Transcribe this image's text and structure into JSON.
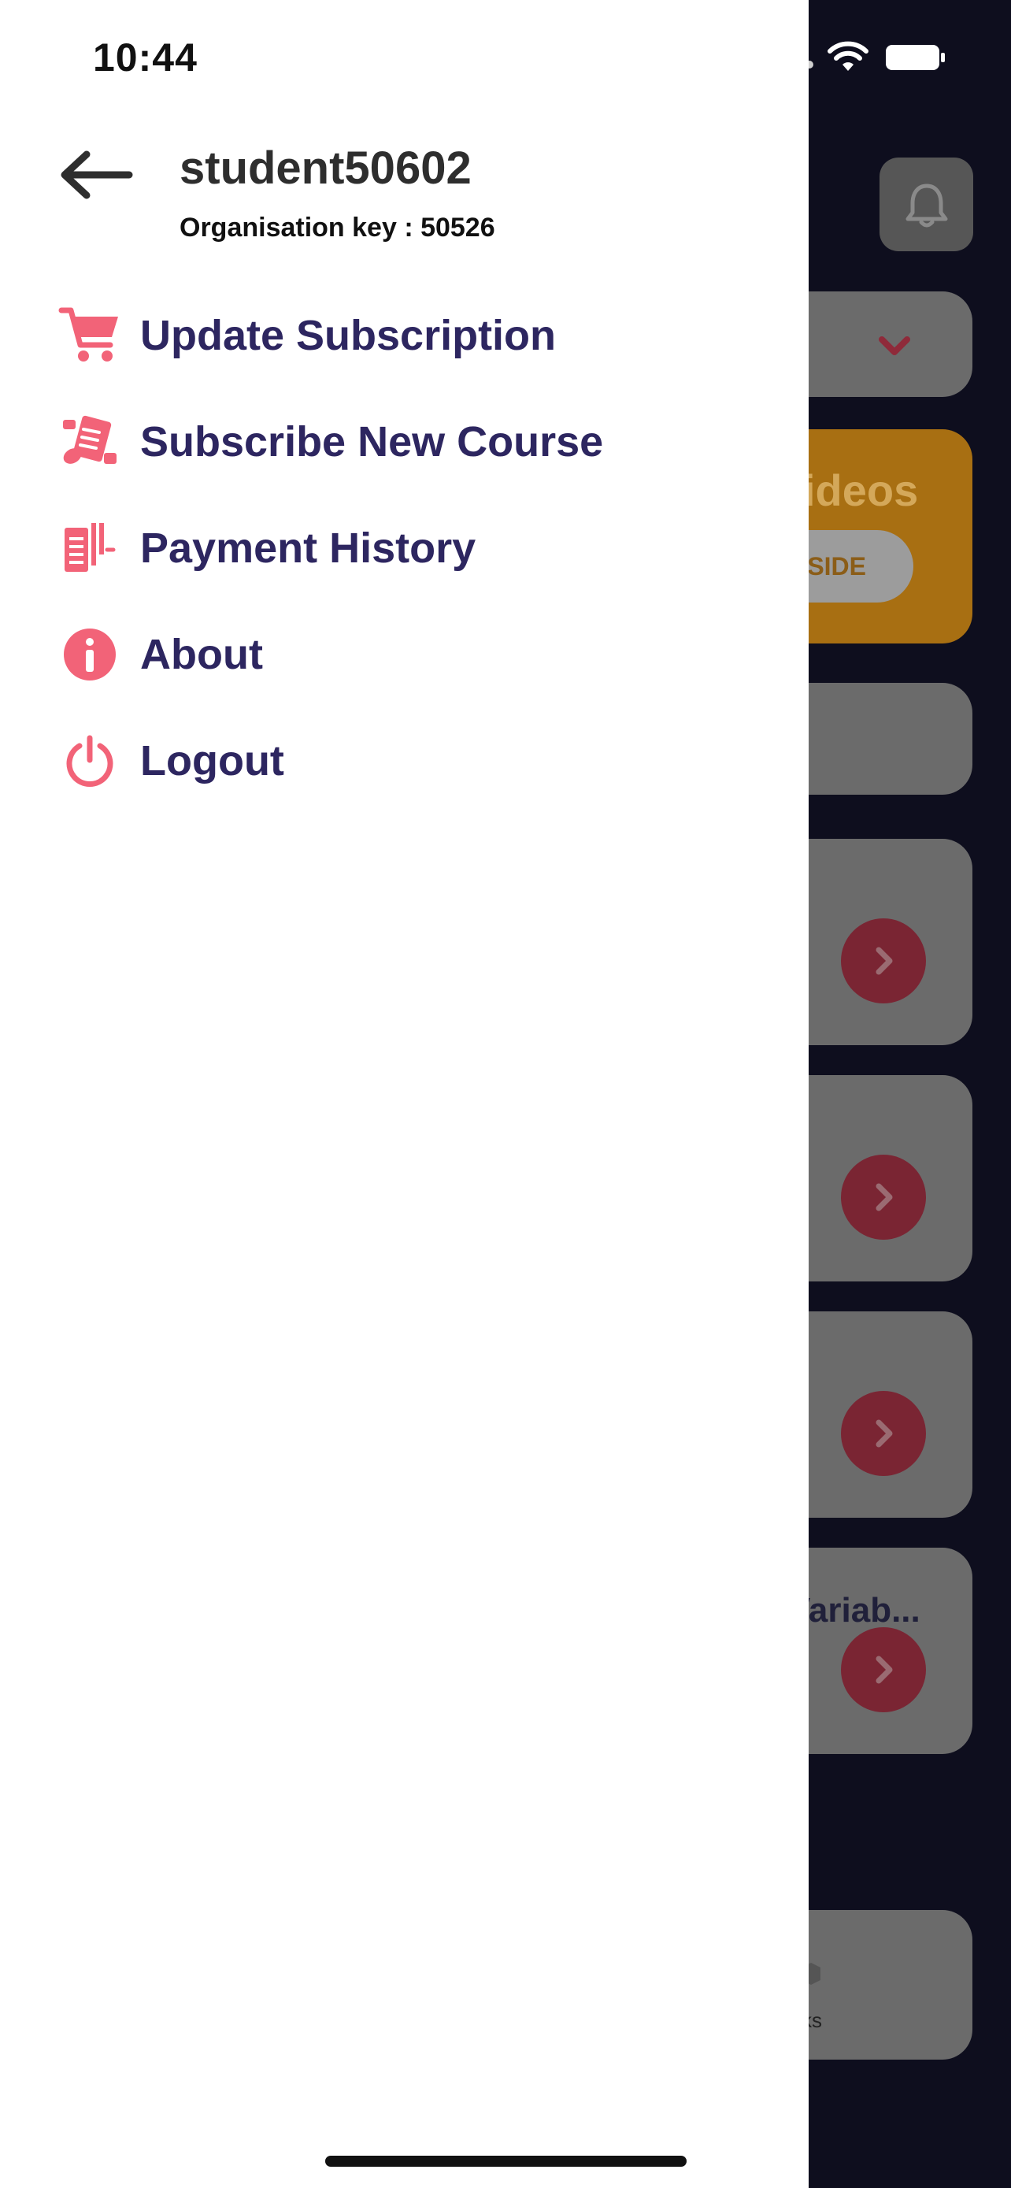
{
  "status_bar": {
    "time": "10:44"
  },
  "drawer": {
    "user_name": "student50602",
    "organisation_key": "Organisation key : 50526",
    "menu": [
      {
        "label": "Update Subscription",
        "icon": "cart-icon"
      },
      {
        "label": "Subscribe New Course",
        "icon": "course-icon"
      },
      {
        "label": "Payment History",
        "icon": "receipt-icon"
      },
      {
        "label": "About",
        "icon": "info-icon"
      },
      {
        "label": "Logout",
        "icon": "power-icon"
      }
    ]
  },
  "background": {
    "promo_title": "ideos",
    "promo_button": "NSIDE",
    "card_title": "Variab...",
    "tab_label": "ks"
  },
  "colors": {
    "accent": "#f26378",
    "menu_text": "#2d2660",
    "drawer_bg": "#ffffff",
    "overlay_bg": "#0e0e1e"
  }
}
